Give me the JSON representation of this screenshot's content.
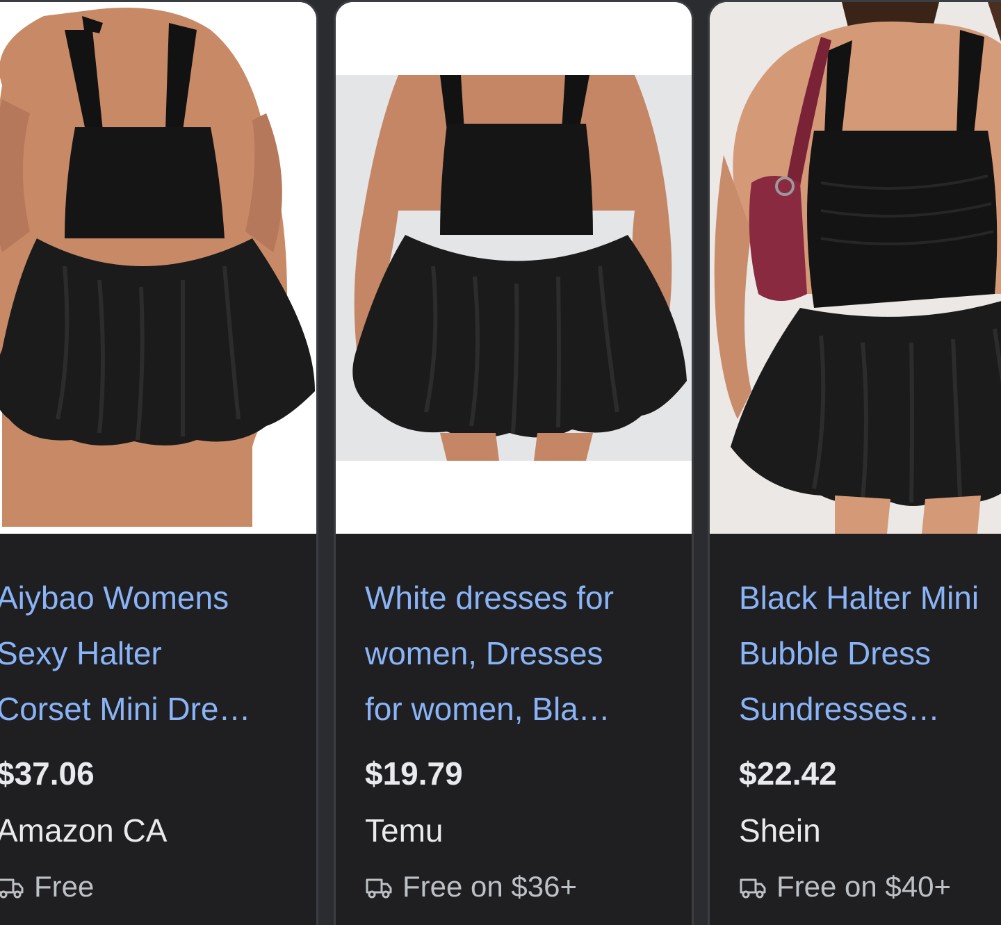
{
  "products": [
    {
      "title": "Aiybao Womens\nSexy Halter\nCorset Mini Dre…",
      "price": "$37.06",
      "merchant": "Amazon CA",
      "shipping": "Free",
      "image": "dress-product-photo"
    },
    {
      "title": "White dresses for\nwomen, Dresses\nfor women, Bla…",
      "price": "$19.79",
      "merchant": "Temu",
      "shipping": "Free on $36+",
      "image": "dress-product-photo"
    },
    {
      "title": "Black Halter Mini\nBubble Dress\nSundresses…",
      "price": "$22.42",
      "merchant": "Shein",
      "shipping": "Free on $40+",
      "image": "dress-product-photo-with-bag"
    }
  ],
  "colors": {
    "link": "#8ab4f8",
    "text": "#e8eaed",
    "muted": "#bdc1c6",
    "card_bg": "#1f1f21"
  },
  "icons": {
    "shipping": "truck-icon"
  }
}
